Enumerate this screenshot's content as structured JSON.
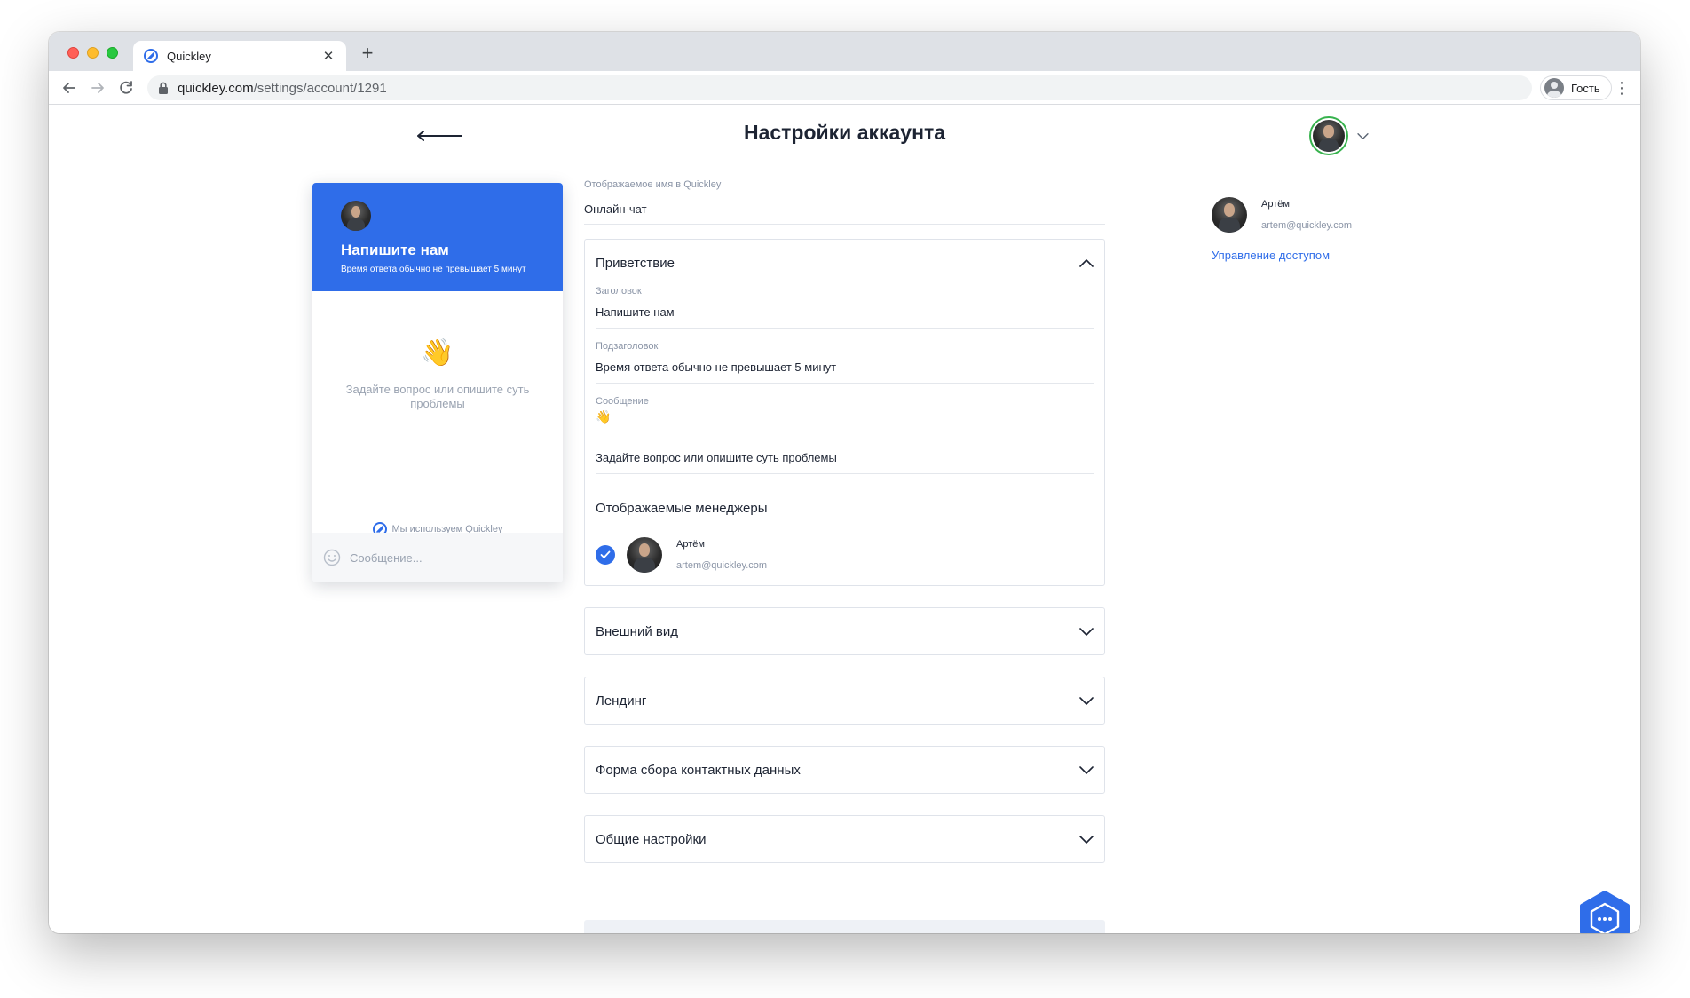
{
  "browser": {
    "tab_title": "Quickley",
    "url_domain": "quickley.com",
    "url_path": "/settings/account/1291",
    "profile_label": "Гость"
  },
  "header": {
    "title": "Настройки аккаунта"
  },
  "widget": {
    "title": "Напишите нам",
    "subtitle": "Время ответа обычно не превышает 5 минут",
    "wave": "👋",
    "message": "Задайте вопрос или опишите суть проблемы",
    "powered": "Мы используем Quickley",
    "input_placeholder": "Сообщение..."
  },
  "form": {
    "display_name_label": "Отображаемое имя в Quickley",
    "display_name_value": "Онлайн-чат",
    "greeting": {
      "title": "Приветствие",
      "heading_label": "Заголовок",
      "heading_value": "Напишите нам",
      "subheading_label": "Подзаголовок",
      "subheading_value": "Время ответа обычно не превышает 5 минут",
      "message_label": "Сообщение",
      "message_emoji": "👋",
      "message_value": "Задайте вопрос или опишите суть проблемы",
      "managers_title": "Отображаемые менеджеры",
      "manager": {
        "name": "Артём",
        "email": "artem@quickley.com"
      }
    },
    "sections": [
      {
        "title": "Внешний вид"
      },
      {
        "title": "Лендинг"
      },
      {
        "title": "Форма сбора контактных данных"
      },
      {
        "title": "Общие настройки"
      }
    ]
  },
  "account": {
    "name": "Артём",
    "email": "artem@quickley.com",
    "manage_link": "Управление доступом"
  },
  "colors": {
    "brand": "#2f6de9",
    "online": "#37b24d"
  }
}
